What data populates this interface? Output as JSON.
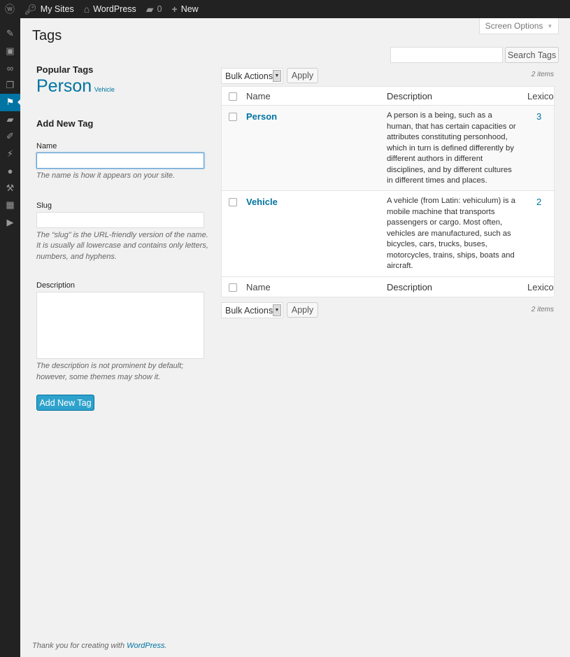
{
  "adminbar": {
    "my_sites": "My Sites",
    "site": "WordPress",
    "comments": "0",
    "new": "New"
  },
  "sidebar": {
    "icons": [
      "pin-icon",
      "media-icon",
      "link-icon",
      "pages-icon",
      "education-icon",
      "comments-icon",
      "appearance-icon",
      "plugins-icon",
      "users-icon",
      "tools-icon",
      "settings-icon",
      "play-icon"
    ],
    "active_index": 4
  },
  "page": {
    "title": "Tags",
    "screen_options": "Screen Options",
    "search_button": "Search Tags",
    "search_value": ""
  },
  "popular": {
    "heading": "Popular Tags",
    "tags": [
      "Person",
      "Vehicle"
    ]
  },
  "form": {
    "heading": "Add New Tag",
    "name_label": "Name",
    "name_hint": "The name is how it appears on your site.",
    "slug_label": "Slug",
    "slug_hint": "The “slug” is the URL-friendly version of the name. It is usually all lowercase and contains only letters, numbers, and hyphens.",
    "desc_label": "Description",
    "desc_hint": "The description is not prominent by default; however, some themes may show it.",
    "submit": "Add New Tag"
  },
  "table": {
    "bulk": "Bulk Actions",
    "apply": "Apply",
    "count": "2 items",
    "columns": [
      "Name",
      "Description",
      "Lexicon"
    ],
    "rows": [
      {
        "name": "Person",
        "description": "A person is a being, such as a human, that has certain capacities or attributes constituting personhood, which in turn is defined differently by different authors in different disciplines, and by different cultures in different times and places.",
        "count": "3"
      },
      {
        "name": "Vehicle",
        "description": "A vehicle (from Latin: vehiculum) is a mobile machine that transports passengers or cargo. Most often, vehicles are manufactured, such as bicycles, cars, trucks, buses, motorcycles, trains, ships, boats and aircraft.",
        "count": "2"
      }
    ]
  },
  "footer": {
    "text": "Thank you for creating with ",
    "link": "WordPress",
    "end": "."
  }
}
